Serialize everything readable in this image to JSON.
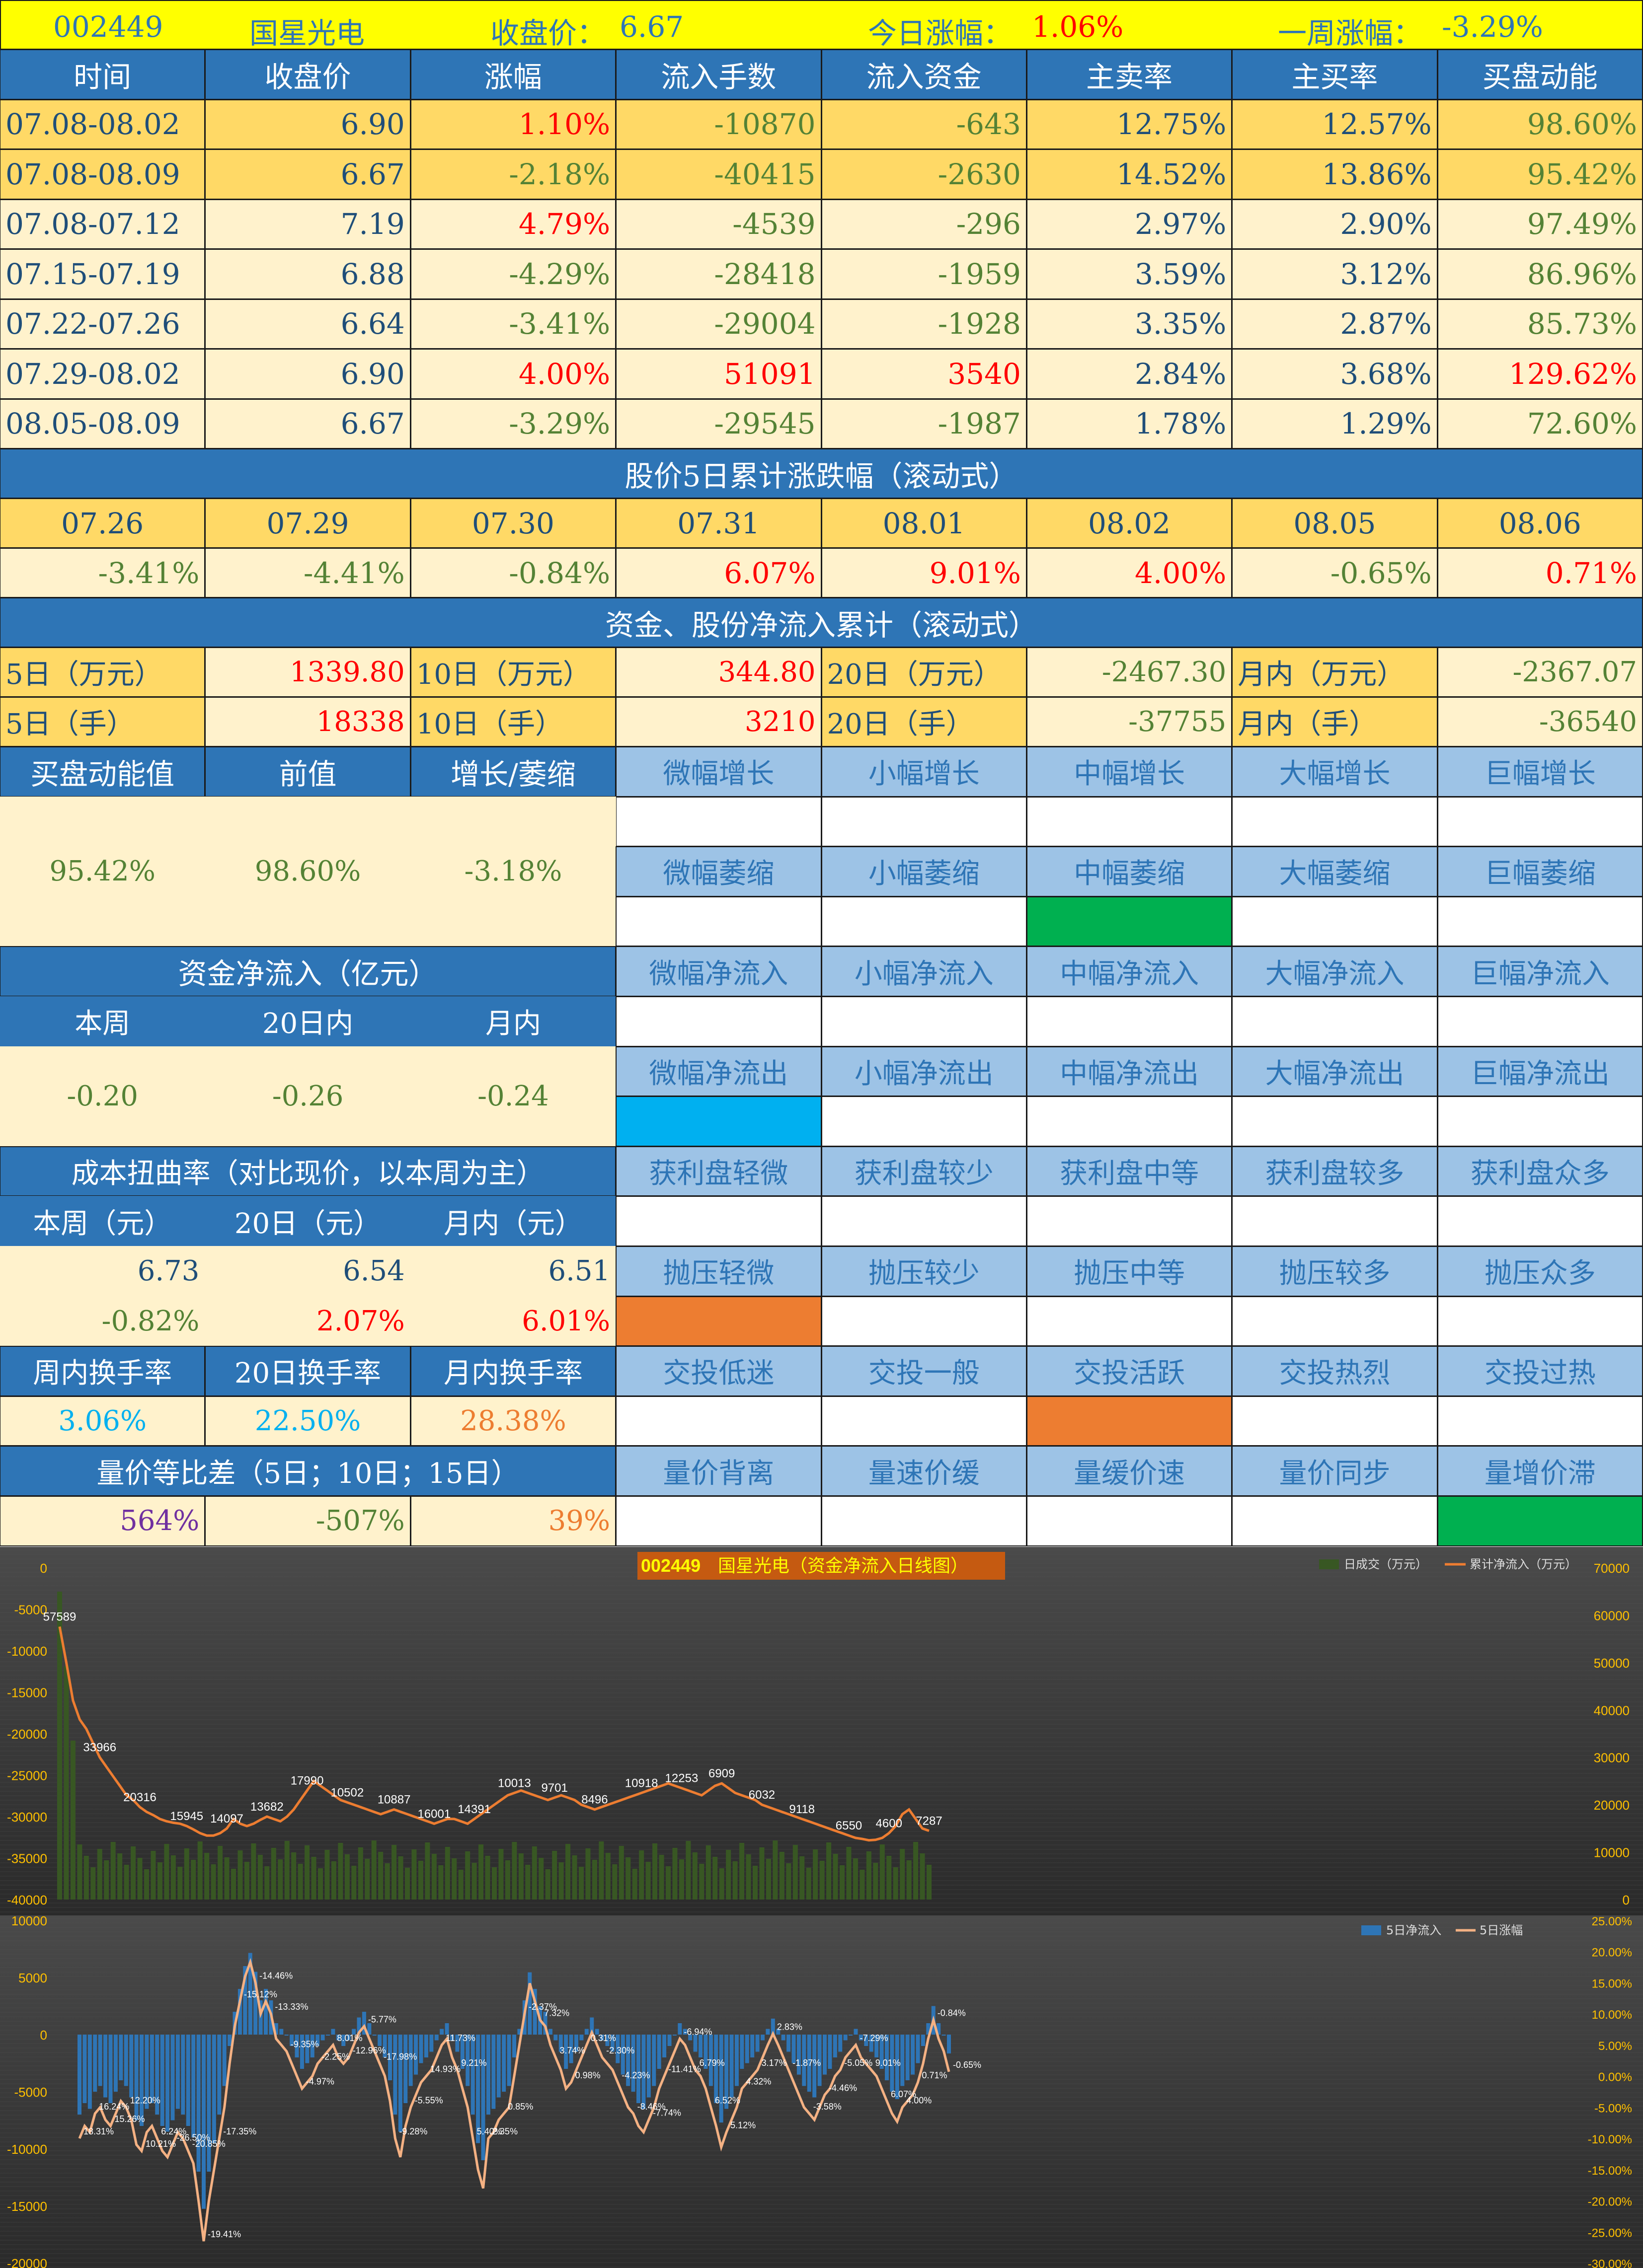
{
  "top": {
    "code": "002449",
    "name": "国星光电",
    "close_label": "收盘价：",
    "close": "6.67",
    "today_label": "今日涨幅：",
    "today": "1.06%",
    "week_label": "一周涨幅：",
    "week": "-3.29%"
  },
  "weekly": {
    "headers": [
      "时间",
      "收盘价",
      "涨幅",
      "流入手数",
      "流入资金",
      "主卖率",
      "主买率",
      "买盘动能"
    ],
    "rows": [
      [
        "07.08-08.02",
        "6.90",
        "1.10%",
        "-10870",
        "-643",
        "12.75%",
        "12.57%",
        "98.60%"
      ],
      [
        "07.08-08.09",
        "6.67",
        "-2.18%",
        "-40415",
        "-2630",
        "14.52%",
        "13.86%",
        "95.42%"
      ],
      [
        "07.08-07.12",
        "7.19",
        "4.79%",
        "-4539",
        "-296",
        "2.97%",
        "2.90%",
        "97.49%"
      ],
      [
        "07.15-07.19",
        "6.88",
        "-4.29%",
        "-28418",
        "-1959",
        "3.59%",
        "3.12%",
        "86.96%"
      ],
      [
        "07.22-07.26",
        "6.64",
        "-3.41%",
        "-29004",
        "-1928",
        "3.35%",
        "2.87%",
        "85.73%"
      ],
      [
        "07.29-08.02",
        "6.90",
        "4.00%",
        "51091",
        "3540",
        "2.84%",
        "3.68%",
        "129.62%"
      ],
      [
        "08.05-08.09",
        "6.67",
        "-3.29%",
        "-29545",
        "-1987",
        "1.78%",
        "1.29%",
        "72.60%"
      ]
    ]
  },
  "rolling": {
    "title": "股价5日累计涨跌幅（滚动式）",
    "dates": [
      "07.26",
      "07.29",
      "07.30",
      "07.31",
      "08.01",
      "08.02",
      "08.05",
      "08.06"
    ],
    "values": [
      "-3.41%",
      "-4.41%",
      "-0.84%",
      "6.07%",
      "9.01%",
      "4.00%",
      "-0.65%",
      "0.71%"
    ]
  },
  "netflow": {
    "title": "资金、股份净流入累计（滚动式）",
    "row1": [
      {
        "label": "5日（万元）",
        "value": "1339.80"
      },
      {
        "label": "10日（万元）",
        "value": "344.80"
      },
      {
        "label": "20日（万元）",
        "value": "-2467.30"
      },
      {
        "label": "月内（万元）",
        "value": "-2367.07"
      }
    ],
    "row2": [
      {
        "label": "5日（手）",
        "value": "18338"
      },
      {
        "label": "10日（手）",
        "value": "3210"
      },
      {
        "label": "20日（手）",
        "value": "-37755"
      },
      {
        "label": "月内（手）",
        "value": "-36540"
      }
    ]
  },
  "momentum": {
    "headers": [
      "买盘动能值",
      "前值",
      "增长/萎缩"
    ],
    "values": [
      "95.42%",
      "98.60%",
      "-3.18%"
    ],
    "grow": [
      "微幅增长",
      "小幅增长",
      "中幅增长",
      "大幅增长",
      "巨幅增长"
    ],
    "shrink": [
      "微幅萎缩",
      "小幅萎缩",
      "中幅萎缩",
      "大幅萎缩",
      "巨幅萎缩"
    ]
  },
  "fund": {
    "title": "资金净流入（亿元）",
    "headers": [
      "本周",
      "20日内",
      "月内"
    ],
    "values": [
      "-0.20",
      "-0.26",
      "-0.24"
    ],
    "inflow": [
      "微幅净流入",
      "小幅净流入",
      "中幅净流入",
      "大幅净流入",
      "巨幅净流入"
    ],
    "outflow": [
      "微幅净流出",
      "小幅净流出",
      "中幅净流出",
      "大幅净流出",
      "巨幅净流出"
    ]
  },
  "cost": {
    "title": "成本扭曲率（对比现价，以本周为主）",
    "headers": [
      "本周（元）",
      "20日（元）",
      "月内（元）"
    ],
    "prices": [
      "6.73",
      "6.54",
      "6.51"
    ],
    "rates": [
      "-0.82%",
      "2.07%",
      "6.01%"
    ],
    "profit": [
      "获利盘轻微",
      "获利盘较少",
      "获利盘中等",
      "获利盘较多",
      "获利盘众多"
    ],
    "pressure": [
      "抛压轻微",
      "抛压较少",
      "抛压中等",
      "抛压较多",
      "抛压众多"
    ]
  },
  "turnover": {
    "headers": [
      "周内换手率",
      "20日换手率",
      "月内换手率"
    ],
    "values": [
      "3.06%",
      "22.50%",
      "28.38%"
    ],
    "levels": [
      "交投低迷",
      "交投一般",
      "交投活跃",
      "交投热烈",
      "交投过热"
    ]
  },
  "volprice": {
    "title": "量价等比差（5日；10日；15日）",
    "values": [
      "564%",
      "-507%",
      "39%"
    ],
    "levels": [
      "量价背离",
      "量速价缓",
      "量缓价速",
      "量价同步",
      "量增价滞"
    ]
  },
  "colors": {
    "header_blue": "#2e75b6",
    "light_blue": "#9dc3e6",
    "yellow": "#ffd966",
    "cream": "#fff2cc",
    "green_mark": "#00b050",
    "blue_mark": "#00b0f0",
    "orange_mark": "#ed7d31"
  },
  "chart_data": [
    {
      "type": "bar",
      "title_code": "002449",
      "title": "国星光电（资金净流入日线图）",
      "series": [
        {
          "name": "日成交（万元）",
          "axis": "left"
        },
        {
          "name": "累计净流入（万元）",
          "axis": "right"
        }
      ],
      "left_ticks": [
        "0",
        "-5000",
        "-10000",
        "-15000",
        "-20000",
        "-25000",
        "-30000",
        "-35000",
        "-40000"
      ],
      "right_ticks": [
        "70000",
        "60000",
        "50000",
        "40000",
        "30000",
        "20000",
        "10000",
        "0"
      ],
      "ylim": [
        -40000,
        0
      ],
      "y2lim": [
        0,
        70000
      ],
      "visible_labels": [
        "57589",
        "33966",
        "20316",
        "15945",
        "14097",
        "13682",
        "17990",
        "10502",
        "10887",
        "16001",
        "14391",
        "10013",
        "9701",
        "8496",
        "10918",
        "12253",
        "6909",
        "6032",
        "9118",
        "6550",
        "4600",
        "7287"
      ],
      "cumulative": [
        57589,
        50000,
        42000,
        38000,
        36000,
        33000,
        30000,
        28000,
        26000,
        24000,
        22000,
        21000,
        19500,
        18500,
        17800,
        17000,
        16500,
        16200,
        16000,
        15500,
        14800,
        14000,
        13500,
        13500,
        14000,
        15000,
        17000,
        16000,
        15500,
        16000,
        16800,
        17500,
        17000,
        16500,
        17500,
        19000,
        21000,
        23000,
        25000,
        24000,
        23000,
        22000,
        21000,
        20500,
        20000,
        19500,
        19000,
        18500,
        18000,
        18500,
        19000,
        18500,
        18000,
        17500,
        17000,
        16500,
        16000,
        16500,
        17000,
        17000,
        16500,
        16000,
        17000,
        18000,
        19000,
        20000,
        21000,
        22000,
        22500,
        23000,
        22500,
        22000,
        21500,
        21000,
        21500,
        22000,
        21500,
        21000,
        20000,
        19500,
        19000,
        19500,
        20000,
        20500,
        21000,
        21500,
        22000,
        22500,
        23000,
        23500,
        24000,
        24500,
        24000,
        23500,
        23000,
        22500,
        22000,
        23000,
        24000,
        24500,
        23500,
        22500,
        22000,
        21500,
        21000,
        20000,
        19500,
        19000,
        18500,
        18000,
        17500,
        17000,
        16500,
        16000,
        15500,
        15000,
        14500,
        14000,
        13500,
        13000,
        12800,
        12500,
        12600,
        13000,
        14000,
        15500,
        18000,
        19000,
        17000,
        15000,
        14500
      ]
    },
    {
      "type": "bar",
      "series": [
        {
          "name": "5日净流入",
          "axis": "left"
        },
        {
          "name": "5日涨幅",
          "axis": "right"
        }
      ],
      "left_ticks": [
        "10000",
        "5000",
        "0",
        "-5000",
        "-10000",
        "-15000",
        "-20000"
      ],
      "right_ticks": [
        "25.00%",
        "20.00%",
        "15.00%",
        "10.00%",
        "5.00%",
        "0.00%",
        "-5.00%",
        "-10.00%",
        "-15.00%",
        "-20.00%",
        "-25.00%",
        "-30.00%"
      ],
      "ylim": [
        -20000,
        10000
      ],
      "y2lim": [
        -30,
        25
      ],
      "visible_labels": [
        "18.31%",
        "16.24%",
        "15.26%",
        "12.20%",
        "10.21%",
        "6.24%",
        "-26.50%",
        "-20.85%",
        "-19.41%",
        "-17.35%",
        "-15.12%",
        "-14.46%",
        "-13.33%",
        "-9.35%",
        "-4.97%",
        "-2.25%",
        "8.01%",
        "-12.96%",
        "-5.77%",
        "-17.98%",
        "-9.28%",
        "-5.55%",
        "14.93%",
        "11.73%",
        "9.21%",
        "5.40%",
        "2.35%",
        "0.85%",
        "-2.37%",
        "7.32%",
        "3.74%",
        "0.98%",
        "0.31%",
        "-2.30%",
        "-4.23%",
        "-8.46%",
        "-7.74%",
        "-11.41%",
        "-6.94%",
        "6.79%",
        "6.52%",
        "5.12%",
        "4.32%",
        "3.17%",
        "2.83%",
        "-1.87%",
        "-3.58%",
        "-4.46%",
        "-5.05%",
        "-7.29%",
        "9.01%",
        "6.07%",
        "4.00%",
        "0.71%",
        "-0.84%",
        "-0.65%"
      ],
      "pct": [
        -10,
        -8,
        -9,
        -6,
        -5,
        -7,
        -8,
        -6,
        -4,
        -5,
        -7,
        -11,
        -12,
        -9,
        -8,
        -10,
        -12,
        -13,
        -11,
        -9,
        -10,
        -12,
        -14,
        -20,
        -26.5,
        -20,
        -15,
        -10,
        -5,
        2,
        8,
        12,
        16,
        18.3,
        15,
        10,
        12,
        10,
        6,
        5,
        4,
        2,
        0,
        -2,
        -1,
        0,
        2,
        3,
        4,
        5,
        3,
        2,
        3,
        5,
        7,
        8,
        6,
        4,
        2,
        0,
        -4,
        -10,
        -13,
        -8,
        -5,
        -3,
        -1,
        0,
        1,
        3,
        5,
        6,
        3,
        1,
        -2,
        -5,
        -10,
        -15,
        -18,
        -10,
        -9,
        -7,
        -6,
        -5,
        0,
        5,
        10,
        14.9,
        12,
        9,
        8,
        5,
        3,
        1,
        -2,
        -1,
        1,
        3,
        5,
        7,
        5,
        3,
        2,
        1,
        -1,
        -3,
        -5,
        -6,
        -8,
        -9,
        -7,
        -5,
        -2,
        0,
        2,
        4,
        6,
        5,
        3,
        1,
        0,
        -2,
        -5,
        -8,
        -11.4,
        -9,
        -7,
        -5,
        -2,
        -1,
        0,
        1,
        3,
        5,
        6.8,
        5,
        3,
        1,
        -1,
        -3,
        -5,
        -6,
        -7,
        -5,
        -3,
        -2,
        0,
        1,
        3,
        4,
        5,
        3,
        2,
        1,
        0,
        -2,
        -4,
        -6,
        -7.3,
        -5,
        -4,
        -3,
        -1,
        2,
        6,
        9,
        6,
        4,
        0.7
      ]
    }
  ]
}
